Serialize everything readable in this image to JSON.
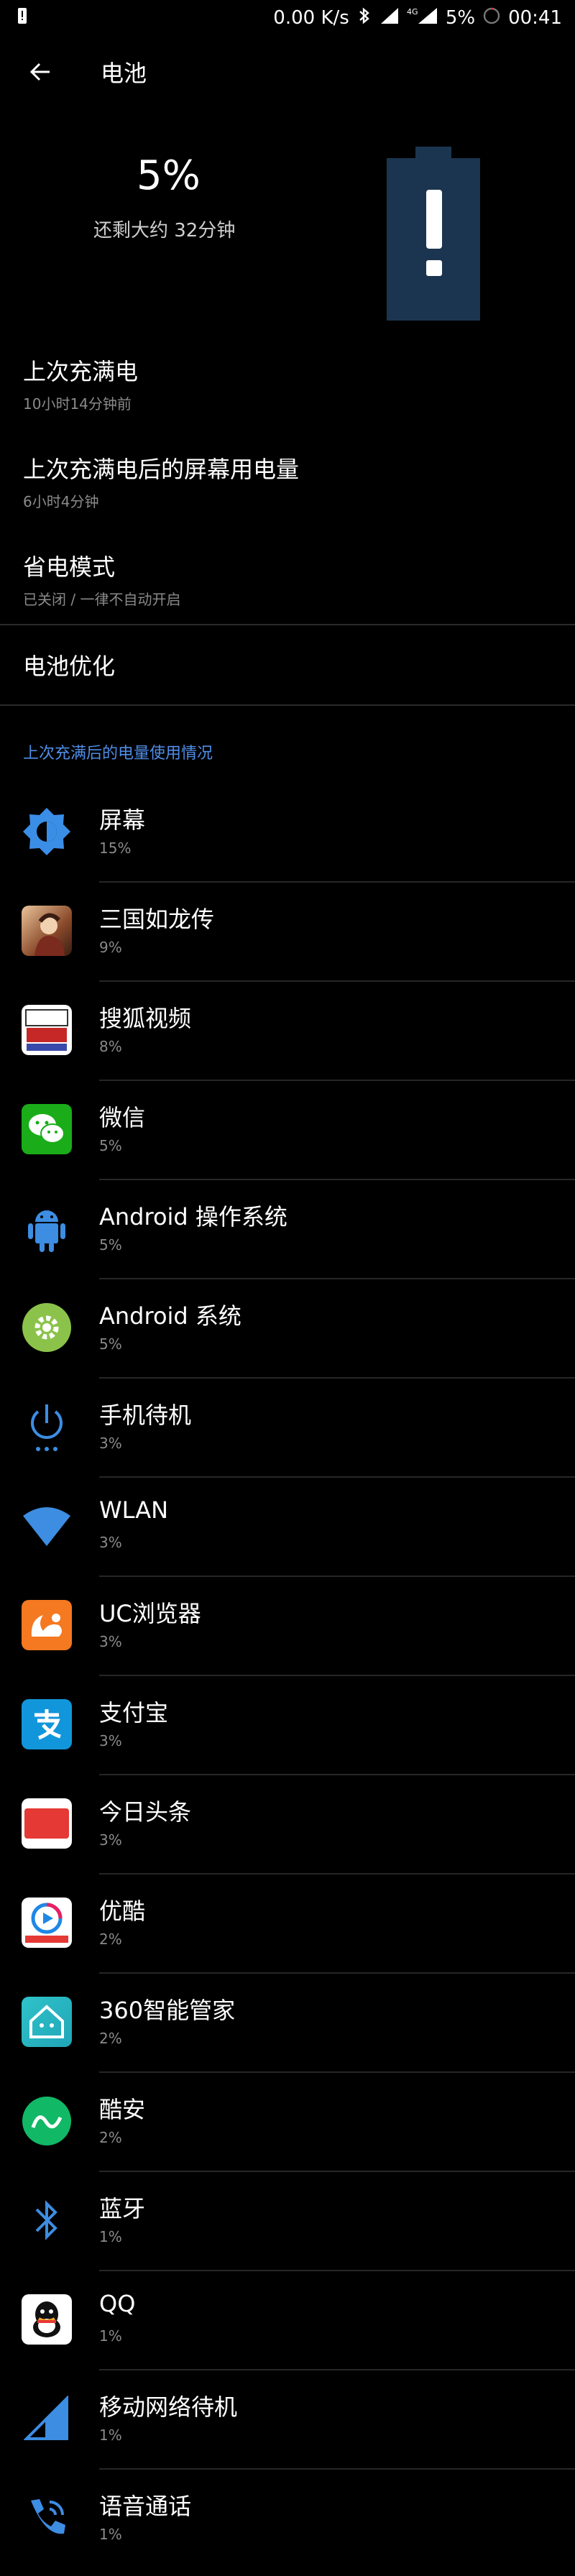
{
  "status_bar": {
    "speed": "0.00 K/s",
    "network": "4G",
    "battery": "5%",
    "time": "00:41"
  },
  "header": {
    "title": "电池"
  },
  "summary": {
    "percent": "5%",
    "remaining": "还剩大约 32分钟"
  },
  "prefs": [
    {
      "title": "上次充满电",
      "subtitle": "10小时14分钟前"
    },
    {
      "title": "上次充满电后的屏幕用电量",
      "subtitle": "6小时4分钟"
    },
    {
      "title": "省电模式",
      "subtitle": "已关闭 / 一律不自动开启"
    },
    {
      "title": "电池优化"
    }
  ],
  "section_title": "上次充满后的电量使用情况",
  "usage": [
    {
      "name": "屏幕",
      "value": "15%",
      "icon": "screen-brightness-icon"
    },
    {
      "name": "三国如龙传",
      "value": "9%",
      "icon": "sanguo-app-icon"
    },
    {
      "name": "搜狐视频",
      "value": "8%",
      "icon": "sohu-video-app-icon"
    },
    {
      "name": "微信",
      "value": "5%",
      "icon": "wechat-app-icon"
    },
    {
      "name": "Android 操作系统",
      "value": "5%",
      "icon": "android-robot-icon"
    },
    {
      "name": "Android 系统",
      "value": "5%",
      "icon": "android-system-gear-icon"
    },
    {
      "name": "手机待机",
      "value": "3%",
      "icon": "power-standby-icon"
    },
    {
      "name": "WLAN",
      "value": "3%",
      "icon": "wifi-icon"
    },
    {
      "name": "UC浏览器",
      "value": "3%",
      "icon": "uc-browser-app-icon"
    },
    {
      "name": "支付宝",
      "value": "3%",
      "icon": "alipay-app-icon"
    },
    {
      "name": "今日头条",
      "value": "3%",
      "icon": "toutiao-app-icon"
    },
    {
      "name": "优酷",
      "value": "2%",
      "icon": "youku-app-icon"
    },
    {
      "name": "360智能管家",
      "value": "2%",
      "icon": "360-home-app-icon"
    },
    {
      "name": "酷安",
      "value": "2%",
      "icon": "coolapk-app-icon"
    },
    {
      "name": "蓝牙",
      "value": "1%",
      "icon": "bluetooth-icon"
    },
    {
      "name": "QQ",
      "value": "1%",
      "icon": "qq-app-icon"
    },
    {
      "name": "移动网络待机",
      "value": "1%",
      "icon": "cell-signal-icon"
    },
    {
      "name": "语音通话",
      "value": "1%",
      "icon": "phone-call-icon"
    }
  ],
  "colors": {
    "accent": "#4f8ee8",
    "battery_fill": "#1b3550",
    "wechat": "#1aad19",
    "android": "#3d8de2",
    "uc": "#f47920",
    "alipay": "#1296db",
    "toutiao": "#e53935"
  }
}
